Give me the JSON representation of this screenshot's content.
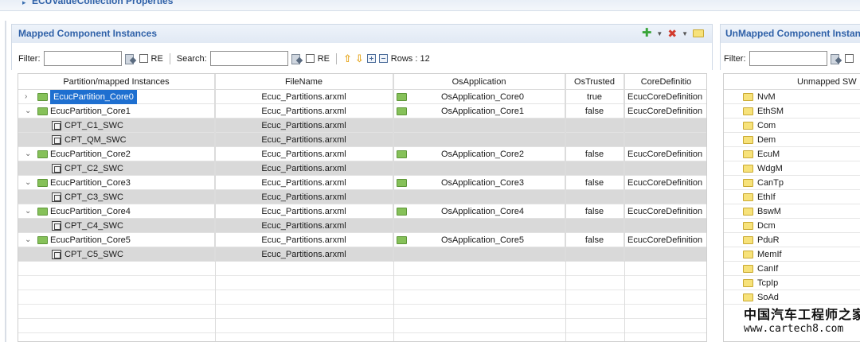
{
  "top_section": {
    "title": "ECUValueCollection Properties"
  },
  "mapped_panel": {
    "title": "Mapped Component Instances",
    "filter_label": "Filter:",
    "re_label": "RE",
    "search_label": "Search:",
    "re2_label": "RE",
    "rows_label": "Rows : 12"
  },
  "table": {
    "columns": [
      "Partition/mapped Instances",
      "FileName",
      "OsApplication",
      "OsTrusted",
      "CoreDefinitio"
    ],
    "rows": [
      {
        "kind": "partition",
        "expand": ">",
        "name": "EcucPartition_Core0",
        "file": "Ecuc_Partitions.arxml",
        "os": "OsApplication_Core0",
        "trusted": "true",
        "core": "EcucCoreDefinition"
      },
      {
        "kind": "partition",
        "expand": "v",
        "name": "EcucPartition_Core1",
        "file": "Ecuc_Partitions.arxml",
        "os": "OsApplication_Core1",
        "trusted": "false",
        "core": "EcucCoreDefinition"
      },
      {
        "kind": "swc",
        "name": "CPT_C1_SWC",
        "file": "Ecuc_Partitions.arxml"
      },
      {
        "kind": "swc",
        "name": "CPT_QM_SWC",
        "file": "Ecuc_Partitions.arxml"
      },
      {
        "kind": "partition",
        "expand": "v",
        "name": "EcucPartition_Core2",
        "file": "Ecuc_Partitions.arxml",
        "os": "OsApplication_Core2",
        "trusted": "false",
        "core": "EcucCoreDefinition"
      },
      {
        "kind": "swc",
        "name": "CPT_C2_SWC",
        "file": "Ecuc_Partitions.arxml"
      },
      {
        "kind": "partition",
        "expand": "v",
        "name": "EcucPartition_Core3",
        "file": "Ecuc_Partitions.arxml",
        "os": "OsApplication_Core3",
        "trusted": "false",
        "core": "EcucCoreDefinition"
      },
      {
        "kind": "swc",
        "name": "CPT_C3_SWC",
        "file": "Ecuc_Partitions.arxml"
      },
      {
        "kind": "partition",
        "expand": "v",
        "name": "EcucPartition_Core4",
        "file": "Ecuc_Partitions.arxml",
        "os": "OsApplication_Core4",
        "trusted": "false",
        "core": "EcucCoreDefinition"
      },
      {
        "kind": "swc",
        "name": "CPT_C4_SWC",
        "file": "Ecuc_Partitions.arxml"
      },
      {
        "kind": "partition",
        "expand": "v",
        "name": "EcucPartition_Core5",
        "file": "Ecuc_Partitions.arxml",
        "os": "OsApplication_Core5",
        "trusted": "false",
        "core": "EcucCoreDefinition"
      },
      {
        "kind": "swc",
        "name": "CPT_C5_SWC",
        "file": "Ecuc_Partitions.arxml"
      }
    ]
  },
  "unmapped_panel": {
    "title": "UnMapped Component Instances",
    "filter_label": "Filter:",
    "column": "Unmapped SW",
    "items": [
      "NvM",
      "EthSM",
      "Com",
      "Dem",
      "EcuM",
      "WdgM",
      "CanTp",
      "EthIf",
      "BswM",
      "Dcm",
      "PduR",
      "MemIf",
      "CanIf",
      "TcpIp",
      "SoAd"
    ]
  },
  "watermark": {
    "cn": "中国汽车工程师之家",
    "url": "www.cartech8.com"
  }
}
